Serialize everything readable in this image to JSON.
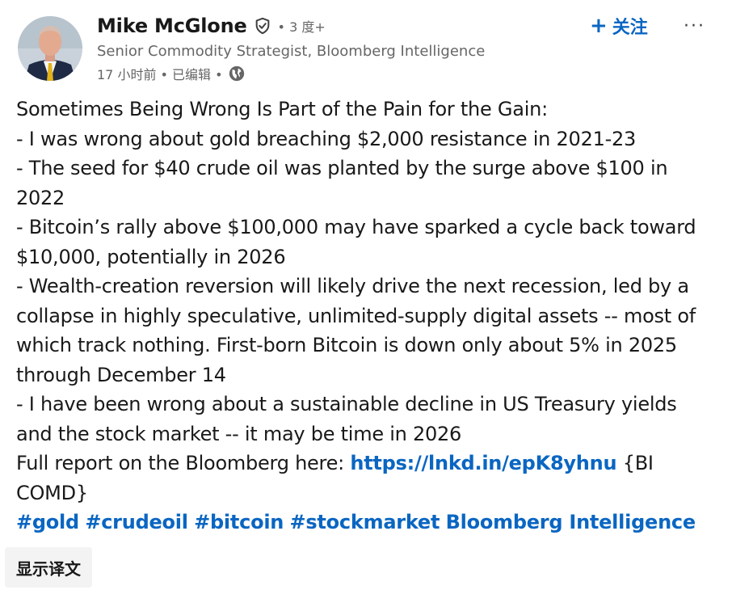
{
  "author": {
    "name": "Mike McGlone",
    "degree": "• 3 度+",
    "headline": "Senior Commodity Strategist, Bloomberg Intelligence",
    "meta": "17 小时前 • 已编辑 •"
  },
  "actions": {
    "follow_label": "关注",
    "more_label": "···"
  },
  "post": {
    "lines": [
      "Sometimes Being Wrong Is Part of the Pain for the Gain:",
      "- I was wrong about gold breaching $2,000 resistance in 2021-23",
      "- The seed for $40 crude oil was planted by the surge above $100 in",
      "2022",
      "- Bitcoin’s rally above $100,000 may have sparked a cycle back toward",
      "$10,000, potentially in 2026",
      "- Wealth-creation reversion will likely drive the next recession, led by a",
      "collapse in highly speculative, unlimited-supply digital assets -- most of",
      "which track nothing. First-born Bitcoin is down only about 5% in 2025",
      "through December 14",
      "- I have been wrong about a sustainable decline in US Treasury yields",
      "and the stock market -- it may be time in 2026"
    ],
    "report_prefix": "Full report on the Bloomberg here: ",
    "report_link": "https://lnkd.in/epK8yhnu",
    "report_suffix": " {BI",
    "report_line2": "COMD}",
    "tags": {
      "gold": "#gold",
      "crudeoil": "#crudeoil",
      "bitcoin": "#bitcoin",
      "stockmarket": "#stockmarket",
      "bloomberg": "Bloomberg Intelligence"
    }
  },
  "translate_label": "显示译文",
  "colors": {
    "link": "#0a66c2",
    "text": "#191919",
    "secondary": "#666666",
    "translate_bg": "#f3f3f3"
  },
  "icons": [
    "verified-shield-icon",
    "globe-icon",
    "plus-icon",
    "more-icon"
  ]
}
